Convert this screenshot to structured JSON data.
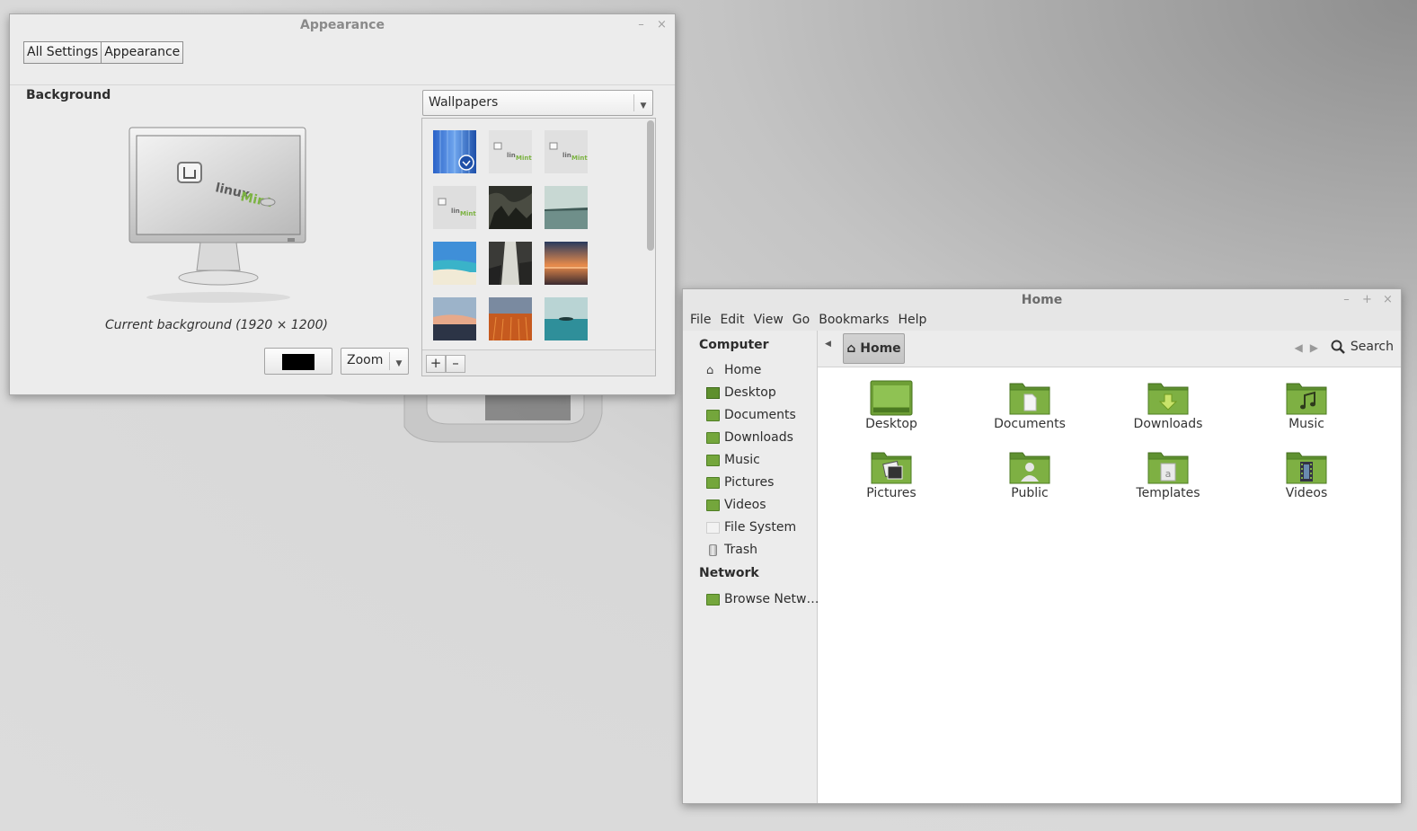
{
  "appearance_window": {
    "title": "Appearance",
    "window_buttons": [
      "–",
      "×"
    ],
    "breadcrumbs": [
      "All Settings",
      "Appearance"
    ],
    "section_title": "Background",
    "current_background_caption": "Current background (1920 × 1200)",
    "color_button_color": "#000000",
    "picture_option": "Zoom",
    "wallpaper_source": "Wallpapers",
    "thumbnail_count_visible": 12,
    "add_button": "+",
    "remove_button": "–"
  },
  "home_window": {
    "title": "Home",
    "window_buttons": [
      "–",
      "+",
      "×"
    ],
    "menu": [
      "File",
      "Edit",
      "View",
      "Go",
      "Bookmarks",
      "Help"
    ],
    "sidebar": {
      "computer_heading": "Computer",
      "computer_items": [
        "Home",
        "Desktop",
        "Documents",
        "Downloads",
        "Music",
        "Pictures",
        "Videos",
        "File System",
        "Trash"
      ],
      "network_heading": "Network",
      "network_items": [
        "Browse Netw…"
      ]
    },
    "path_current": "Home",
    "search_label": "Search",
    "folders": [
      "Desktop",
      "Documents",
      "Downloads",
      "Music",
      "Pictures",
      "Public",
      "Templates",
      "Videos"
    ]
  },
  "colors": {
    "folder_green": "#7bab3f",
    "folder_dark": "#4f7e25",
    "window_bg": "#ececec"
  }
}
